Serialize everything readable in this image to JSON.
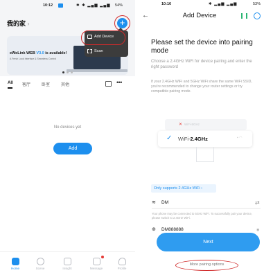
{
  "left": {
    "status": {
      "time": "10:12",
      "right": "54%"
    },
    "home_title": "我的家",
    "home_chevron": "›",
    "add_plus": "+",
    "popup": {
      "add_device": "Add Device",
      "scan": "Scan"
    },
    "banner": {
      "title_prefix": "eWeLink WEB ",
      "title_ver": "V3.0",
      "title_suffix": " is available!",
      "subtitle": "A Fresh Look Interface & Seamless Control"
    },
    "tabs": [
      "All",
      "客厅",
      "卧室",
      "其他"
    ],
    "empty_text": "No devices yet",
    "add_button": "Add",
    "nav": [
      "Home",
      "Scene",
      "Insight",
      "Message",
      "Profile"
    ]
  },
  "right": {
    "status": {
      "time": "10:16",
      "right": "53%"
    },
    "back": "←",
    "title": "Add Device",
    "heading": "Please set the device into pairing mode",
    "choose_text": "Choose a 2.4GHz WiFi for device pairing and enter the right password",
    "info_text": "If your 2.4GHz WiFi and 5GHz WiFi share the same WiFi SSID, you're recommended to change your router settings or try compatible pairing mode.",
    "wifi_5g": "WiFi-5GHz",
    "wifi_24_prefix": "WiFi-",
    "wifi_24_bold": "2.4GHz",
    "only_supports": "Only supports 2.4GHz WiFi ›",
    "ssid": "DM",
    "notice": "Your phone may be connected to 5GHz WiFi. To successfully pair your device, please switch to 2.4GHz WiFi.",
    "password": "DM888888",
    "next_button": "Next",
    "more_options": "More pairing options"
  },
  "colors": {
    "accent": "#1d8fee",
    "red": "#d12a2a",
    "green": "#2bb673"
  }
}
